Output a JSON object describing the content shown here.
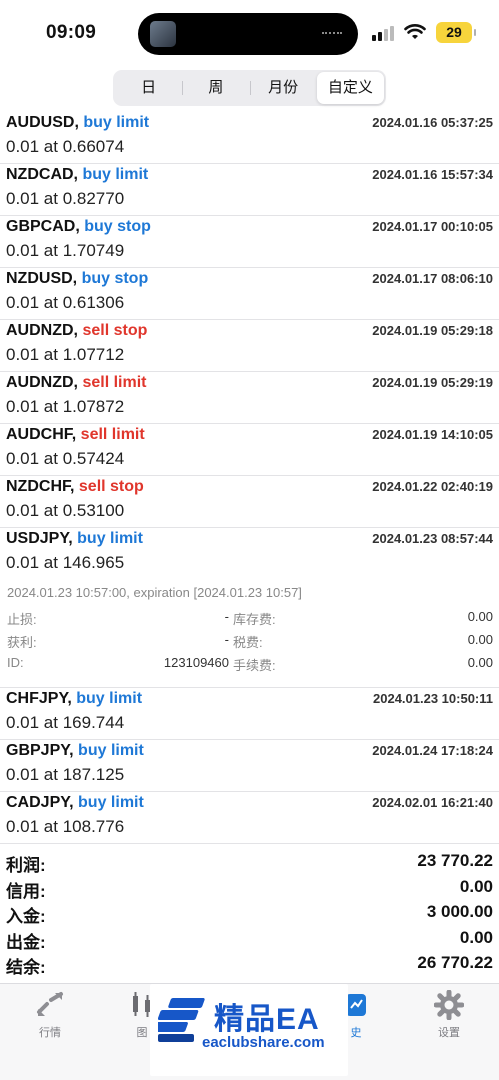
{
  "status_bar": {
    "time": "09:09",
    "battery": "29"
  },
  "segments": [
    {
      "label": "日"
    },
    {
      "label": "周"
    },
    {
      "label": "月份"
    },
    {
      "label": "自定义"
    }
  ],
  "orders": [
    {
      "symbol": "AUDUSD,",
      "type": "buy limit",
      "side": "buy",
      "time": "2024.01.16 05:37:25",
      "price": "0.01 at 0.66074"
    },
    {
      "symbol": "NZDCAD,",
      "type": "buy limit",
      "side": "buy",
      "time": "2024.01.16 15:57:34",
      "price": "0.01 at 0.82770"
    },
    {
      "symbol": "GBPCAD,",
      "type": "buy stop",
      "side": "buy",
      "time": "2024.01.17 00:10:05",
      "price": "0.01 at 1.70749"
    },
    {
      "symbol": "NZDUSD,",
      "type": "buy stop",
      "side": "buy",
      "time": "2024.01.17 08:06:10",
      "price": "0.01 at 0.61306"
    },
    {
      "symbol": "AUDNZD,",
      "type": "sell stop",
      "side": "sell",
      "time": "2024.01.19 05:29:18",
      "price": "0.01 at 1.07712"
    },
    {
      "symbol": "AUDNZD,",
      "type": "sell limit",
      "side": "sell",
      "time": "2024.01.19 05:29:19",
      "price": "0.01 at 1.07872"
    },
    {
      "symbol": "AUDCHF,",
      "type": "sell limit",
      "side": "sell",
      "time": "2024.01.19 14:10:05",
      "price": "0.01 at 0.57424"
    },
    {
      "symbol": "NZDCHF,",
      "type": "sell stop",
      "side": "sell",
      "time": "2024.01.22 02:40:19",
      "price": "0.01 at 0.53100"
    },
    {
      "symbol": "USDJPY,",
      "type": "buy limit",
      "side": "buy",
      "time": "2024.01.23 08:57:44",
      "price": "0.01 at 146.965"
    },
    {
      "symbol": "CHFJPY,",
      "type": "buy limit",
      "side": "buy",
      "time": "2024.01.23 10:50:11",
      "price": "0.01 at 169.744"
    },
    {
      "symbol": "GBPJPY,",
      "type": "buy limit",
      "side": "buy",
      "time": "2024.01.24 17:18:24",
      "price": "0.01 at 187.125"
    },
    {
      "symbol": "CADJPY,",
      "type": "buy limit",
      "side": "buy",
      "time": "2024.02.01 16:21:40",
      "price": "0.01 at 108.776"
    }
  ],
  "detail": {
    "line": "2024.01.23 10:57:00, expiration [2024.01.23 10:57]",
    "rows": [
      {
        "l1": "止损:",
        "v1": "-",
        "l2": "库存费:",
        "v2": "0.00"
      },
      {
        "l1": "获利:",
        "v1": "-",
        "l2": "税费:",
        "v2": "0.00"
      },
      {
        "l1": "ID:",
        "v1": "123109460",
        "l2": "手续费:",
        "v2": "0.00"
      }
    ]
  },
  "summary": [
    {
      "label": "利润:",
      "value": "23 770.22"
    },
    {
      "label": "信用:",
      "value": "0.00"
    },
    {
      "label": "入金:",
      "value": "3 000.00"
    },
    {
      "label": "出金:",
      "value": "0.00"
    },
    {
      "label": "结余:",
      "value": "26 770.22"
    }
  ],
  "tabs": [
    {
      "label": "行情",
      "icon": "quotes-icon"
    },
    {
      "label": "图",
      "icon": "chart-icon"
    },
    {
      "label": "史",
      "icon": "history-icon"
    },
    {
      "label": "设置",
      "icon": "gear-icon"
    }
  ],
  "watermark": {
    "title": "精品EA",
    "url": "eaclubshare.com"
  },
  "colors": {
    "buy": "#1e78d6",
    "sell": "#e0362c",
    "accent": "#1e78d6"
  }
}
